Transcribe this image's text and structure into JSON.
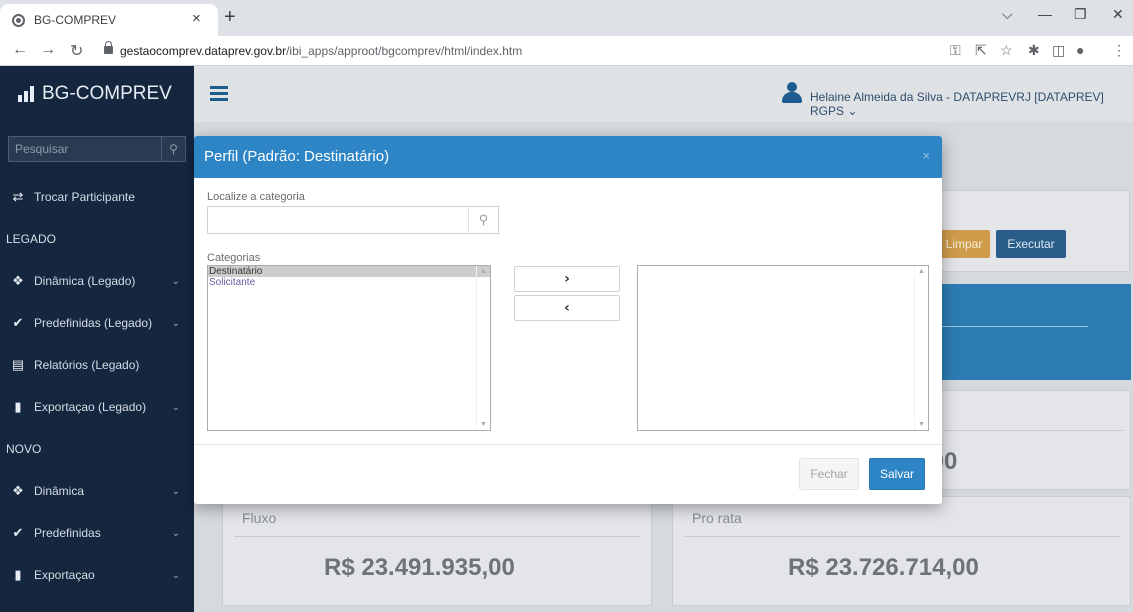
{
  "browser": {
    "tab_title": "BG-COMPREV",
    "tab_close": "×",
    "new_tab": "+",
    "url_host": "gestaocomprev.dataprev.gov.br",
    "url_path": "/ibi_apps/approot/bgcomprev/html/index.htm"
  },
  "app": {
    "brand": "BG-COMPREV",
    "search_placeholder": "Pesquisar",
    "user": "Helaine Almeida da Silva - DATAPREVRJ [DATAPREV] RGPS",
    "user_caret": "⌄"
  },
  "sidebar": {
    "items": [
      {
        "type": "item",
        "icon": "swap-icon",
        "glyph": "⇄",
        "label": "Trocar Participante",
        "chevron": false
      },
      {
        "type": "section",
        "label": "LEGADO"
      },
      {
        "type": "item",
        "icon": "cubes-icon",
        "glyph": "❖",
        "label": "Dinâmica (Legado)",
        "chevron": true
      },
      {
        "type": "item",
        "icon": "check-icon",
        "glyph": "✔",
        "label": "Predefinidas (Legado)",
        "chevron": true
      },
      {
        "type": "item",
        "icon": "document-icon",
        "glyph": "▤",
        "label": "Relatórios (Legado)",
        "chevron": false
      },
      {
        "type": "item",
        "icon": "file-icon",
        "glyph": "▮",
        "label": "Exportaçao (Legado)",
        "chevron": true
      },
      {
        "type": "section",
        "label": "NOVO"
      },
      {
        "type": "item",
        "icon": "cubes-icon",
        "glyph": "❖",
        "label": "Dinâmica",
        "chevron": true
      },
      {
        "type": "item",
        "icon": "check-icon",
        "glyph": "✔",
        "label": "Predefinidas",
        "chevron": true
      },
      {
        "type": "item",
        "icon": "file-icon",
        "glyph": "▮",
        "label": "Exportaçao",
        "chevron": true
      }
    ]
  },
  "main": {
    "limpar_label": "Limpar",
    "executar_label": "Executar",
    "partial_value": ",00",
    "cards": [
      {
        "title": "Fluxo",
        "value": "R$ 23.491.935,00"
      },
      {
        "title": "Pro rata",
        "value": "R$ 23.726.714,00"
      }
    ]
  },
  "modal": {
    "title": "Perfil (Padrão: Destinatário)",
    "close": "×",
    "find_label": "Localize a categoria",
    "find_value": "",
    "categories_label": "Categorias",
    "available": [
      {
        "label": "Destinatário",
        "selected": true
      },
      {
        "label": "Solicitante",
        "selected": false
      }
    ],
    "chosen": [],
    "move_right": "›",
    "move_left": "‹",
    "close_label": "Fechar",
    "save_label": "Salvar"
  },
  "colors": {
    "sidebar_bg": "#15263f",
    "modal_header": "#2e85c6",
    "button_primary": "#2e85c6",
    "button_warning": "#cf9c4c"
  }
}
